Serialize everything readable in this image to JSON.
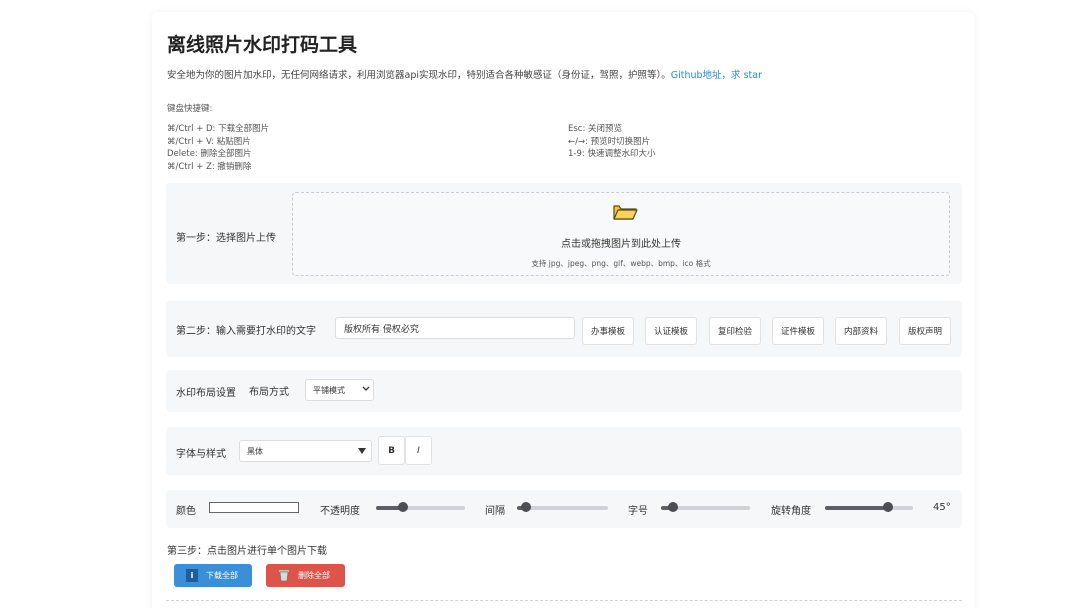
{
  "header": {
    "title": "离线照片水印打码工具",
    "description": "安全地为你的图片加水印，无任何网络请求，利用浏览器api实现水印，特别适合各种敏感证（身份证，驾照，护照等）。",
    "github_link": "Github地址，求 star"
  },
  "shortcuts": {
    "title": "键盘快捷键:",
    "left": [
      "⌘/Ctrl + D: 下载全部图片",
      "⌘/Ctrl + V: 粘贴图片",
      "Delete: 删除全部图片",
      "⌘/Ctrl + Z: 撤销删除"
    ],
    "right": [
      "Esc: 关闭预览",
      "←/→: 预览时切换图片",
      "1-9: 快速调整水印大小"
    ]
  },
  "step1": {
    "label": "第一步：选择图片上传",
    "upload_text": "点击或拖拽图片到此处上传",
    "upload_hint": "支持 jpg、jpeg、png、gif、webp、bmp、ico 格式"
  },
  "step2": {
    "label": "第二步：输入需要打水印的文字",
    "input_value": "版权所有 侵权必究",
    "templates": [
      "办事模板",
      "认证模板",
      "复印检验",
      "证件模板",
      "内部资料",
      "版权声明"
    ]
  },
  "layout": {
    "label": "水印布局设置",
    "mode_label": "布局方式",
    "mode_value": "平铺模式"
  },
  "font": {
    "label": "字体与样式",
    "family_value": "黑体",
    "bold_label": "B",
    "italic_label": "I"
  },
  "controls": {
    "color_label": "颜色",
    "color_value": "#ffffff",
    "opacity_label": "不透明度",
    "opacity_fraction": 0.3,
    "spacing_label": "间隔",
    "spacing_fraction": 0.1,
    "size_label": "字号",
    "size_fraction": 0.13,
    "rotation_label": "旋转角度",
    "rotation_fraction": 0.72,
    "rotation_display": "45°"
  },
  "step3": {
    "label": "第三步：点击图片进行单个图片下载",
    "download_all": "下载全部",
    "delete_all": "删除全部",
    "download_color": "#3b8fd8",
    "delete_color": "#e0534a"
  }
}
